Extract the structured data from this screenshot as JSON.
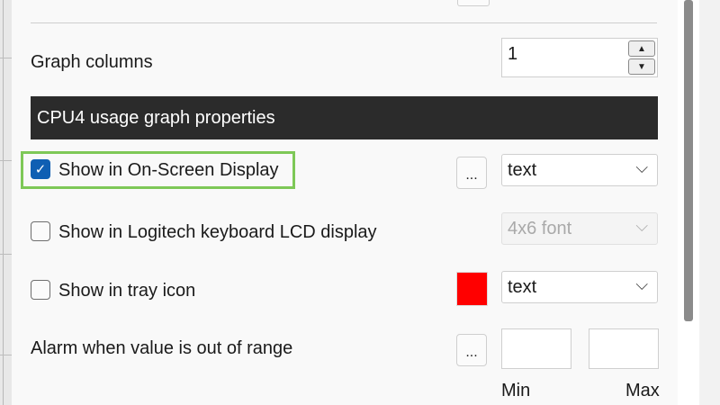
{
  "graph_columns": {
    "label": "Graph columns",
    "value": "1",
    "up_glyph": "▲",
    "down_glyph": "▼"
  },
  "section": {
    "title": "CPU4 usage graph properties"
  },
  "osd": {
    "label": "Show in On-Screen Display",
    "checked": true,
    "check_glyph": "✓",
    "more_label": "...",
    "format": "text",
    "chevron": "⌵"
  },
  "lcd": {
    "label": "Show in Logitech keyboard LCD display",
    "checked": false,
    "font": "4x6 font",
    "chevron": "⌵"
  },
  "tray": {
    "label": "Show in tray icon",
    "checked": false,
    "color": "#ff0000",
    "format": "text",
    "chevron": "⌵"
  },
  "alarm": {
    "label": "Alarm when value is out of range",
    "more_label": "...",
    "min_label": "Min",
    "max_label": "Max",
    "min_value": "",
    "max_value": ""
  },
  "colors": {
    "highlight": "#7ec857",
    "checkbox_checked": "#0f5fb3",
    "header_bg": "#2b2b2b",
    "scroll_thumb": "#8b8b8b"
  }
}
